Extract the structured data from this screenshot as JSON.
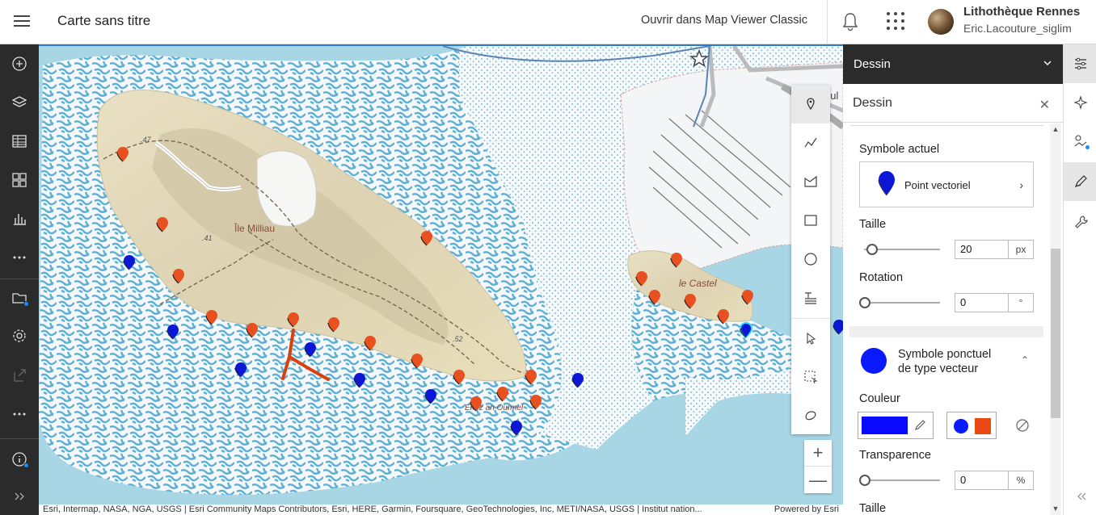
{
  "header": {
    "map_title": "Carte sans titre",
    "open_classic": "Ouvrir dans Map Viewer Classic",
    "user_name": "Lithothèque Rennes",
    "user_id": "Eric.Lacouture_siglim"
  },
  "left_toolbar": {
    "items": [
      "add-icon",
      "layers-icon",
      "table-icon",
      "basemap-gallery-icon",
      "charts-icon",
      "more-icon",
      "save-folder-icon",
      "settings-icon",
      "share-icon",
      "more-icon",
      "info-icon",
      "expand-icon"
    ]
  },
  "map": {
    "labels": {
      "island_main": "Île Milliau",
      "island_small": "le Castel",
      "place": "Enez an Ourmel",
      "spot_47": ".47",
      "spot_41": ".41",
      "spot_52": ".52",
      "road_fragment": "oul"
    },
    "marker_colors": {
      "orange": "#e8501f",
      "blue": "#0b17d4"
    },
    "attribution": "Esri, Intermap, NASA, NGA, USGS | Esri Community Maps Contributors, Esri, HERE, Garmin, Foursquare, GeoTechnologies, Inc, METI/NASA, USGS | Institut nation...",
    "powered_by": "Powered by Esri"
  },
  "draw_tools": [
    "point-tool",
    "polyline-tool",
    "polygon-tool",
    "rectangle-tool",
    "circle-tool",
    "text-tool",
    "select-tool",
    "select-rectangle-tool",
    "lasso-tool"
  ],
  "zoom": {
    "in": "+",
    "out": "—"
  },
  "panel": {
    "header_title": "Dessin",
    "sub_title": "Dessin",
    "current_symbol_label": "Symbole actuel",
    "current_symbol_name": "Point vectoriel",
    "size_label": "Taille",
    "size_value": "20",
    "size_unit": "px",
    "size_slider_fraction": 0.1,
    "rotation_label": "Rotation",
    "rotation_value": "0",
    "rotation_unit": "°",
    "section_title_line1": "Symbole ponctuel",
    "section_title_line2": "de type vecteur",
    "color_label": "Couleur",
    "color_value": "#0a0aff",
    "recent_colors": [
      "#0a1aff",
      "#e84a14"
    ],
    "transparency_label": "Transparence",
    "transparency_value": "0",
    "transparency_unit": "%",
    "bottom_label": "Taille"
  },
  "right_toolbar": [
    "properties-icon",
    "effects-icon",
    "styles-icon",
    "sketch-icon",
    "configure-icon",
    "collapse-icon"
  ]
}
